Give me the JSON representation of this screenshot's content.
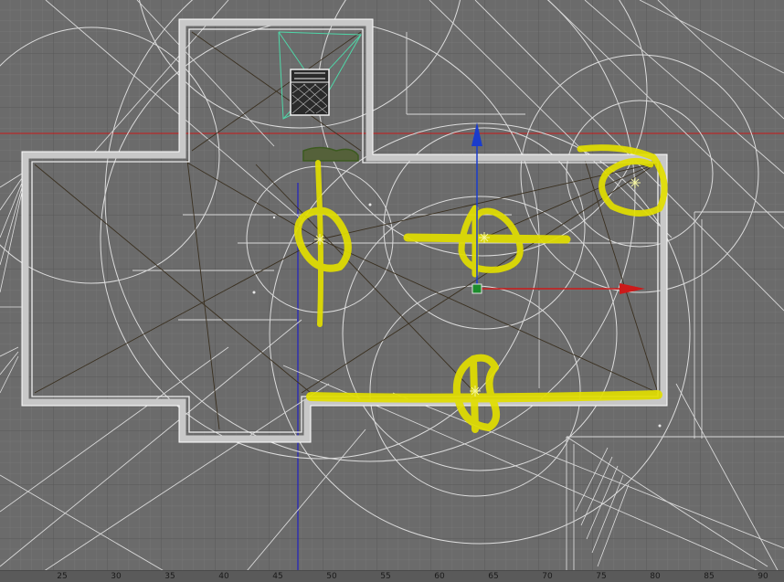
{
  "viewport": {
    "name": "Top",
    "mode": "wireframe",
    "background": "#6b6b6b",
    "grid_minor_color": "#7a7a7a",
    "grid_major_color": "#5c5c5c",
    "wire_color": "#e8e8e8",
    "markup_color": "#e2de00",
    "camera_color": "#4fd7a8",
    "axis_x_color": "#c81818",
    "axis_y_color": "#2020c0"
  },
  "ruler": {
    "ticks": [
      "25",
      "30",
      "35",
      "40",
      "45",
      "50",
      "55",
      "60",
      "65",
      "70",
      "75",
      "80",
      "85",
      "90"
    ]
  },
  "gizmo": {
    "x_axis_color": "#cc1a1a",
    "y_axis_color": "#1a3ccc",
    "center_color": "#1c8c2c"
  }
}
